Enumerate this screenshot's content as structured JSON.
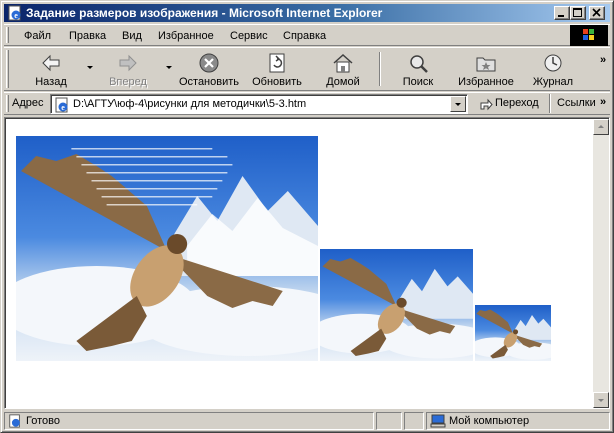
{
  "window": {
    "title": "Задание размеров изображения - Microsoft Internet Explorer"
  },
  "menu": {
    "items": [
      "Файл",
      "Правка",
      "Вид",
      "Избранное",
      "Сервис",
      "Справка"
    ]
  },
  "toolbar": {
    "back": "Назад",
    "forward": "Вперед",
    "stop": "Остановить",
    "refresh": "Обновить",
    "home": "Домой",
    "search": "Поиск",
    "favorites": "Избранное",
    "history": "Журнал"
  },
  "address": {
    "label": "Адрес",
    "value": "D:\\АГТУ\\юф-4\\рисунки для методички\\5-3.htm",
    "go": "Переход",
    "links": "Ссылки"
  },
  "status": {
    "text": "Готово",
    "zone": "Мой компьютер"
  },
  "colors": {
    "titlebar_start": "#0a246a",
    "titlebar_end": "#a6caf0",
    "chrome": "#d4d0c8",
    "sky": "#2f6fd0"
  }
}
